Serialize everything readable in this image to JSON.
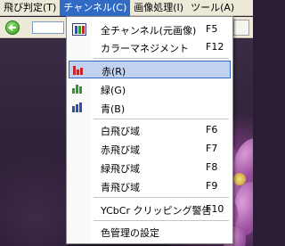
{
  "menubar": {
    "items": [
      {
        "label": "飛び判定(T)"
      },
      {
        "label": "チャンネル(C)"
      },
      {
        "label": "画像処理(I)"
      },
      {
        "label": "ツール(A)"
      }
    ]
  },
  "channel_menu": {
    "items": [
      {
        "label": "全チャンネル(元画像)",
        "shortcut": "F5",
        "icon": "rgb-bars-icon"
      },
      {
        "label": "カラーマネジメント",
        "shortcut": "F12"
      },
      {
        "label": "赤(R)",
        "shortcut": "",
        "icon": "red-bars-icon",
        "selected": true
      },
      {
        "label": "緑(G)",
        "shortcut": "",
        "icon": "green-bars-icon"
      },
      {
        "label": "青(B)",
        "shortcut": "",
        "icon": "blue-bars-icon"
      },
      {
        "label": "白飛び域",
        "shortcut": "F6"
      },
      {
        "label": "赤飛び域",
        "shortcut": "F7"
      },
      {
        "label": "緑飛び域",
        "shortcut": "F8"
      },
      {
        "label": "青飛び域",
        "shortcut": "F9"
      },
      {
        "label": "YCbCr クリッピング警告",
        "shortcut": "F10"
      },
      {
        "label": "色管理の設定",
        "shortcut": ""
      }
    ]
  },
  "colors": {
    "highlight": "#316ac5",
    "selected_bg": "#c1d2ee",
    "red": "#c0282a",
    "green": "#2e9a2e",
    "blue": "#2f4fa8"
  }
}
